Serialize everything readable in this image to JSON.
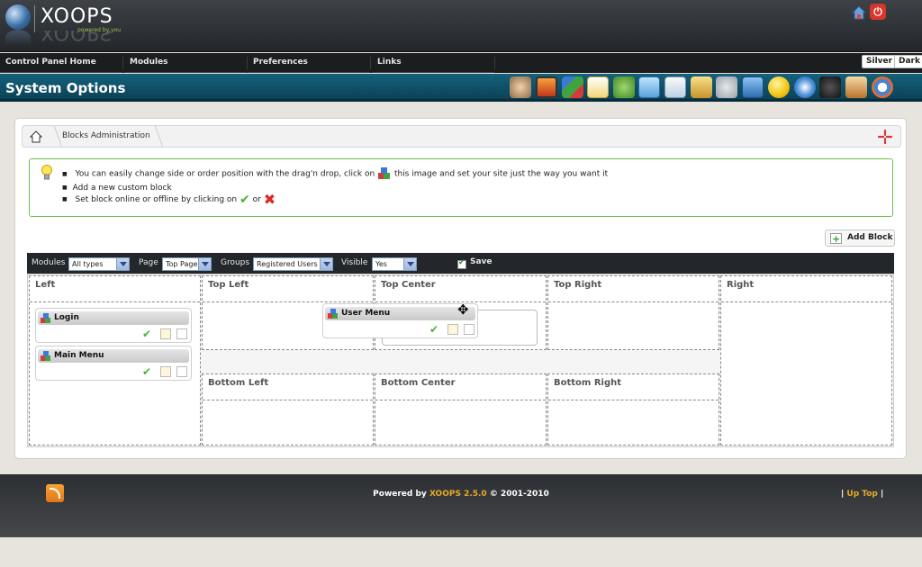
{
  "header": {
    "logo_text": "XOOPS",
    "logo_tagline": "powered by you"
  },
  "nav": {
    "items": [
      "Control Panel Home",
      "Modules",
      "Preferences",
      "Links"
    ],
    "themes": [
      "Silver",
      "Dark"
    ]
  },
  "title": "System Options",
  "toolbar_icons": [
    "avatars-icon",
    "banners-icon",
    "blocks-icon",
    "comments-icon",
    "groups-icon",
    "images-icon",
    "maintenance-icon",
    "mail-icon",
    "modules-icon",
    "preferences-icon",
    "smilies-icon",
    "templates-icon",
    "userrank-icon",
    "users-icon",
    "tips-icon"
  ],
  "breadcrumb": {
    "label": "Blocks Administration"
  },
  "tips": {
    "line1_a": "You can easily change side or order position with the drag'n drop, click on",
    "line1_b": "this image and set your site just the way you want it",
    "line2": "Add a new custom block",
    "line3_a": "Set block online or offline by clicking on",
    "line3_b": "or"
  },
  "add_block": "Add Block",
  "filter": {
    "modules_label": "Modules",
    "modules_value": "All types",
    "page_label": "Page",
    "page_value": "Top Page",
    "groups_label": "Groups",
    "groups_value": "Registered Users",
    "visible_label": "Visible",
    "visible_value": "Yes",
    "save_label": "Save"
  },
  "zones": {
    "left": "Left",
    "top_left": "Top Left",
    "top_center": "Top Center",
    "top_right": "Top Right",
    "right": "Right",
    "bottom_left": "Bottom Left",
    "bottom_center": "Bottom Center",
    "bottom_right": "Bottom Right"
  },
  "blocks": {
    "login": "Login",
    "main_menu": "Main Menu",
    "user_menu": "User Menu"
  },
  "footer": {
    "powered_prefix": "Powered by",
    "powered_brand": "XOOPS 2.5.0",
    "powered_suffix": "© 2001-2010",
    "up_top": "Up Top"
  },
  "colors": {
    "title_bar": "#0b4257",
    "tips_border": "#6cc14d",
    "accent": "#e8a92a"
  }
}
